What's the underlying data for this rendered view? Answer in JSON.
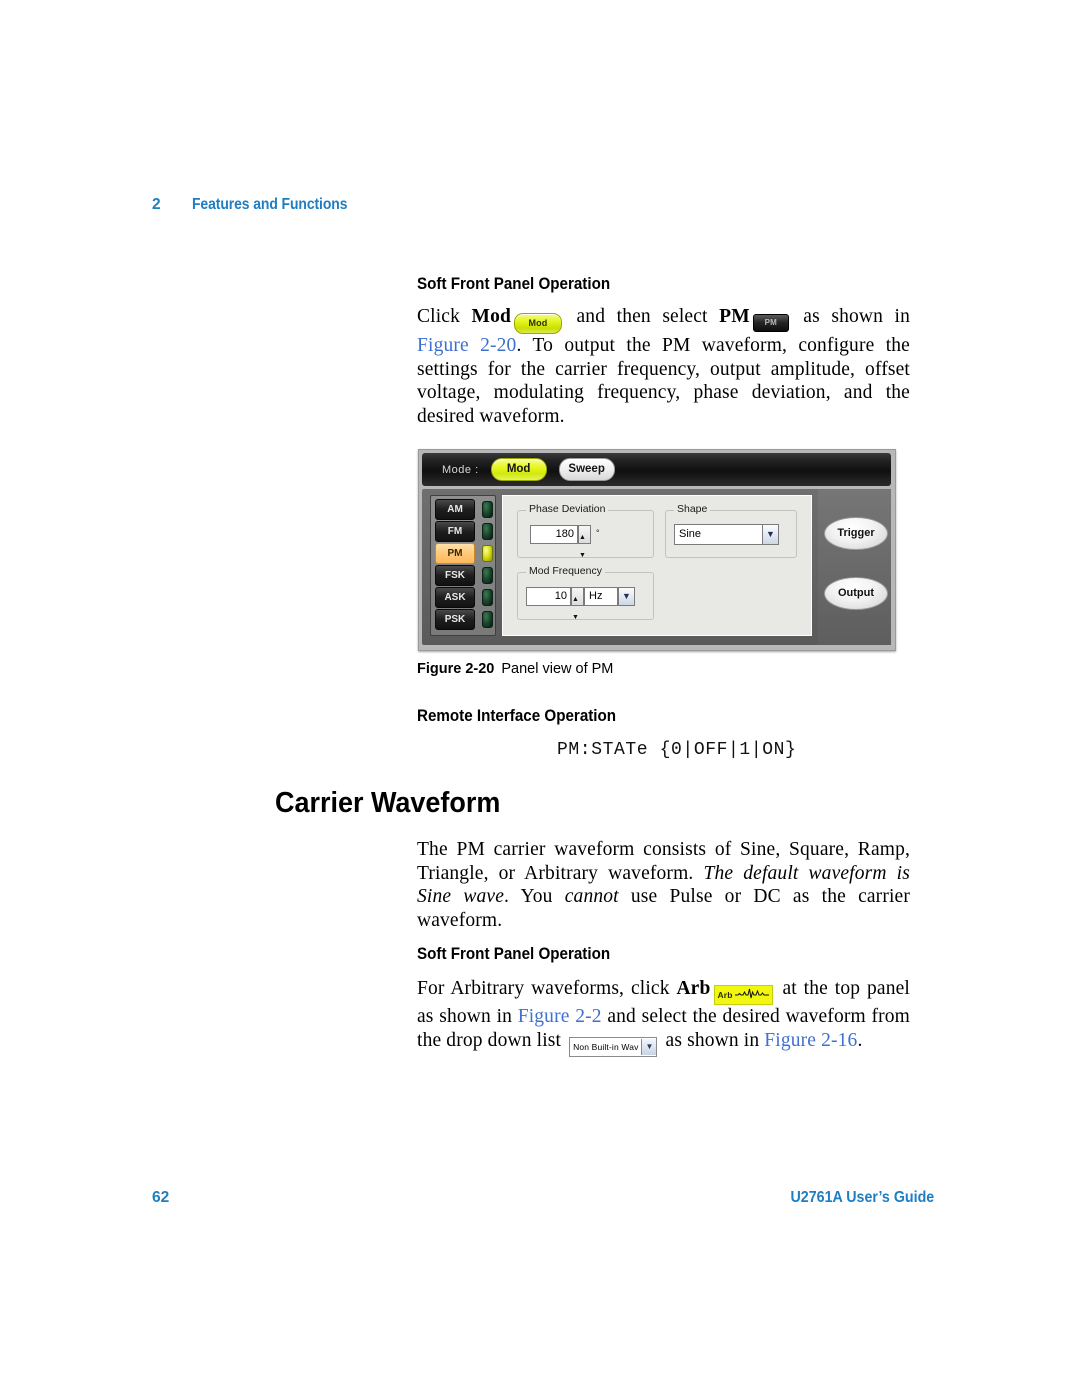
{
  "header": {
    "chapter_number": "2",
    "chapter_title": "Features and Functions"
  },
  "section_pm": {
    "soft_front_panel_heading": "Soft Front Panel Operation",
    "paragraph": {
      "part1": "Click ",
      "bold_mod": "Mod",
      "mod_chip_label": "Mod",
      "part2": " and then select ",
      "bold_pm": "PM",
      "pm_chip_label": "PM",
      "part3": " as shown in ",
      "xref_figure": "Figure 2-20",
      "part4": ". To output the PM waveform, configure the settings for the carrier frequency, output amplitude, offset voltage, modulating frequency, phase deviation, and the desired waveform."
    },
    "remote_interface_heading": "Remote Interface Operation",
    "scpi_command": "PM:STATe {0|OFF|1|ON}"
  },
  "figure": {
    "mode_label": "Mode :",
    "mode_buttons": [
      {
        "label": "Mod",
        "active": true
      },
      {
        "label": "Sweep",
        "active": false
      }
    ],
    "mod_types": [
      {
        "label": "AM",
        "selected": false,
        "led": "off"
      },
      {
        "label": "FM",
        "selected": false,
        "led": "off"
      },
      {
        "label": "PM",
        "selected": true,
        "led": "on"
      },
      {
        "label": "FSK",
        "selected": false,
        "led": "off"
      },
      {
        "label": "ASK",
        "selected": false,
        "led": "off"
      },
      {
        "label": "PSK",
        "selected": false,
        "led": "off"
      }
    ],
    "phase_deviation": {
      "group_label": "Phase Deviation",
      "value": "180",
      "unit_symbol": "°"
    },
    "mod_frequency": {
      "group_label": "Mod Frequency",
      "value": "10",
      "unit": "Hz"
    },
    "shape": {
      "group_label": "Shape",
      "value": "Sine"
    },
    "actions": [
      {
        "label": "Trigger"
      },
      {
        "label": "Output"
      }
    ],
    "caption_number": "Figure 2-20",
    "caption_text": "Panel view of PM"
  },
  "section_carrier": {
    "heading": "Carrier Waveform",
    "paragraph": {
      "part1": "The PM carrier waveform consists of Sine, Square, Ramp, Triangle, or Arbitrary waveform. ",
      "italic1": "The default waveform is Sine wave",
      "part2": ". You ",
      "italic2": "cannot",
      "part3": " use Pulse or DC as the carrier waveform."
    },
    "soft_front_panel_heading": "Soft Front Panel Operation",
    "paragraph2": {
      "part1": "For Arbitrary waveforms, click ",
      "bold_arb": "Arb",
      "arb_chip_label": "Arb",
      "part2": " at the top panel as shown in ",
      "xref_figure_2_2": "Figure 2-2",
      "part3": " and select the desired waveform from the drop down list ",
      "dropdown_label": "Non Built-in Wav",
      "part4": " as shown in ",
      "xref_figure_2_16": "Figure 2-16",
      "part5": "."
    }
  },
  "footer": {
    "page_number": "62",
    "guide_title": "U2761A User’s Guide"
  },
  "colors": {
    "accent_blue": "#1f7ec2",
    "xref_blue": "#3f6fd0",
    "active_yellow": "#e8f827",
    "selected_orange": "#ffc877"
  }
}
